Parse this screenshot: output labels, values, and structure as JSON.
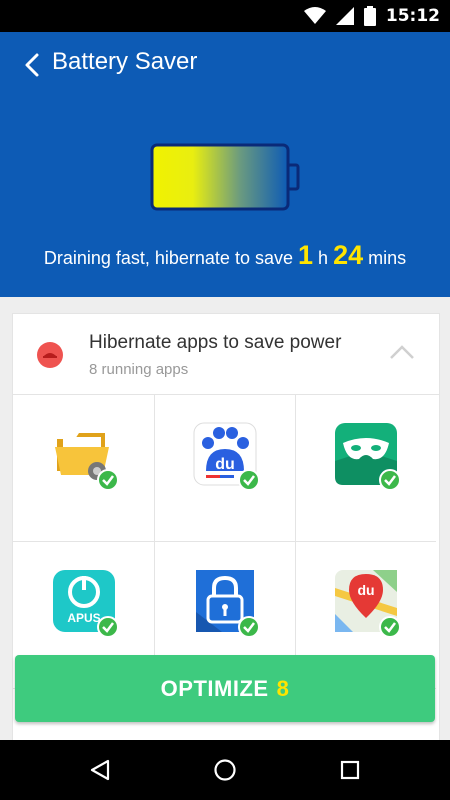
{
  "status_bar": {
    "time": "15:12",
    "icons": [
      "wifi-icon",
      "signal-icon",
      "battery-status-icon"
    ]
  },
  "header": {
    "title": "Battery Saver",
    "back_icon": "arrow-left-icon",
    "drain_prefix": "Draining fast, hibernate to save",
    "hours": "1",
    "hours_unit": "h",
    "minutes": "24",
    "minutes_unit": "mins",
    "accent": "#ffe400",
    "bg": "#0d5bb5"
  },
  "card": {
    "title": "Hibernate apps to save power",
    "subtitle": "8 running apps",
    "apps": [
      {
        "name": "file-manager-app-icon",
        "checked": true
      },
      {
        "name": "baidu-du-app-icon",
        "checked": true,
        "label": "du"
      },
      {
        "name": "mask-app-icon",
        "checked": true
      },
      {
        "name": "apus-app-icon",
        "checked": true,
        "label": "APUS"
      },
      {
        "name": "app-lock-icon",
        "checked": true
      },
      {
        "name": "du-maps-app-icon",
        "checked": true,
        "label": "du"
      }
    ]
  },
  "optimize": {
    "label": "OPTIMIZE",
    "count": "8",
    "color": "#3ecb7e"
  },
  "nav_bar": {
    "icons": [
      "back-triangle-icon",
      "home-circle-icon",
      "recents-square-icon"
    ]
  }
}
